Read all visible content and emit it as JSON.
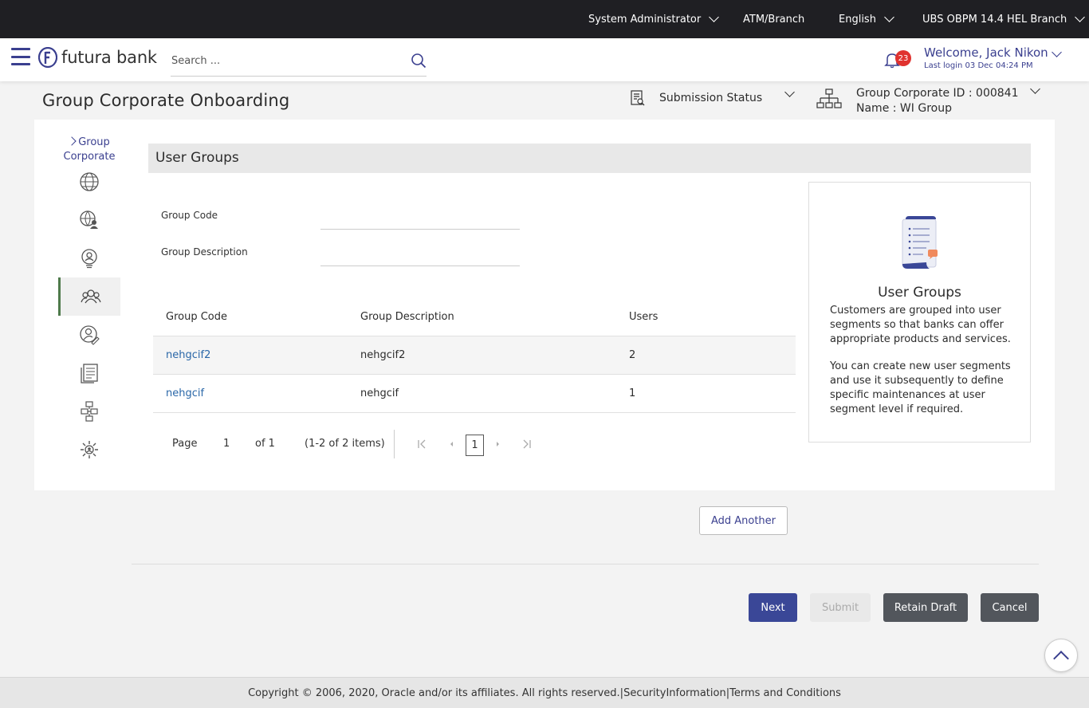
{
  "topbar": {
    "role": "System Administrator",
    "channel": "ATM/Branch",
    "language": "English",
    "branch": "UBS OBPM 14.4 HEL Branch"
  },
  "header": {
    "logo_text": "futura bank",
    "search_placeholder": "Search ...",
    "notification_count": "23",
    "welcome": "Welcome, Jack Nikon",
    "last_login": "Last login 03 Dec 04:24 PM"
  },
  "page": {
    "title": "Group Corporate Onboarding",
    "submission_status": "Submission Status",
    "group_corporate_id": "Group Corporate ID : 000841",
    "group_name": "Name : WI Group"
  },
  "sidebar": {
    "title": "Group Corporate",
    "items": [
      "globe",
      "users-globe",
      "user-badge",
      "user-groups",
      "user-edit",
      "documents",
      "workflow",
      "settings-users"
    ],
    "active_index": 3
  },
  "section": {
    "title": "User Groups",
    "fields": [
      {
        "label": "Group Code",
        "value": ""
      },
      {
        "label": "Group Description",
        "value": ""
      }
    ]
  },
  "table": {
    "columns": [
      "Group Code",
      "Group Description",
      "Users"
    ],
    "rows": [
      {
        "code": "nehgcif2",
        "description": "nehgcif2",
        "users": "2"
      },
      {
        "code": "nehgcif",
        "description": "nehgcif",
        "users": "1"
      }
    ]
  },
  "pagination": {
    "page_label": "Page",
    "page_value": "1",
    "of_label": "of 1",
    "items_label": "(1-2 of 2 items)",
    "current_page": "1"
  },
  "info": {
    "title": "User Groups",
    "para1": "Customers are grouped into user segments so that banks can offer appropriate products and services.",
    "para2": "You can create new user segments and use it subsequently to define specific maintenances at user segment level if required."
  },
  "buttons": {
    "add_another": "Add Another",
    "next": "Next",
    "submit": "Submit",
    "retain_draft": "Retain Draft",
    "cancel": "Cancel"
  },
  "footer": {
    "copyright": "Copyright © 2006, 2020, Oracle and/or its affiliates. All rights reserved.",
    "separator": "|",
    "security": "SecurityInformation",
    "terms": "Terms and Conditions"
  },
  "colors": {
    "primary": "#3a4797",
    "brand_text": "#3a3f8f",
    "link": "#2a67a8",
    "badge": "#e0322f",
    "topbar_bg": "#1f1f23"
  }
}
